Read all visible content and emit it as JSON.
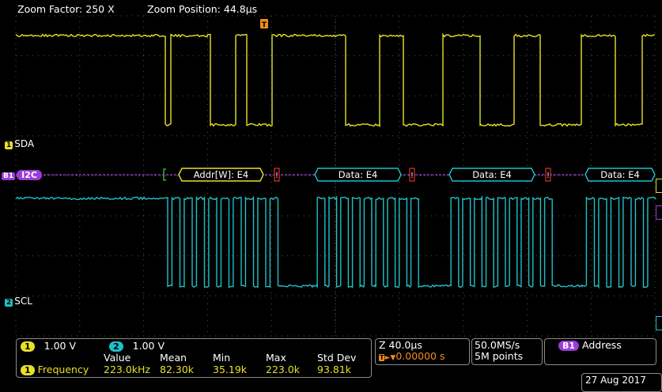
{
  "header": {
    "zoom_factor": "Zoom Factor: 250 X",
    "zoom_position": "Zoom Position: 44.8µs"
  },
  "trigger_marker": "T",
  "channels": {
    "sda": {
      "label": "SDA",
      "number": "1",
      "color": "#e8e028"
    },
    "scl": {
      "label": "SCL",
      "number": "2",
      "color": "#20c0c8"
    },
    "bus": {
      "label": "I2C",
      "number": "B1",
      "color": "#9a3cd8"
    }
  },
  "bus_packets": [
    {
      "label": "Addr[W]: E4",
      "type": "address"
    },
    {
      "label": "Data: E4",
      "type": "data"
    },
    {
      "label": "Data: E4",
      "type": "data"
    },
    {
      "label": "Data: E4",
      "type": "data"
    }
  ],
  "bottom": {
    "ch1_scale": "1.00 V",
    "ch2_scale": "1.00 V",
    "meas_headers": [
      "Value",
      "Mean",
      "Min",
      "Max",
      "Std Dev"
    ],
    "meas_source": "1",
    "meas_name": "Frequency",
    "meas_values": [
      "223.0kHz",
      "82.30k",
      "35.19k",
      "223.0k",
      "93.81k"
    ],
    "horizontal_scale": "Z 40.0µs",
    "trigger_offset": "0.00000 s",
    "sample_rate": "50.0MS/s",
    "record_length": "5M points",
    "bus_mark": "B1",
    "bus_display": "Address",
    "date": "27 Aug 2017"
  },
  "colors": {
    "grid": "#555555",
    "yellow": "#e8e028",
    "cyan": "#20c0c8",
    "purple": "#9a3cd8",
    "orange": "#f08a20"
  }
}
